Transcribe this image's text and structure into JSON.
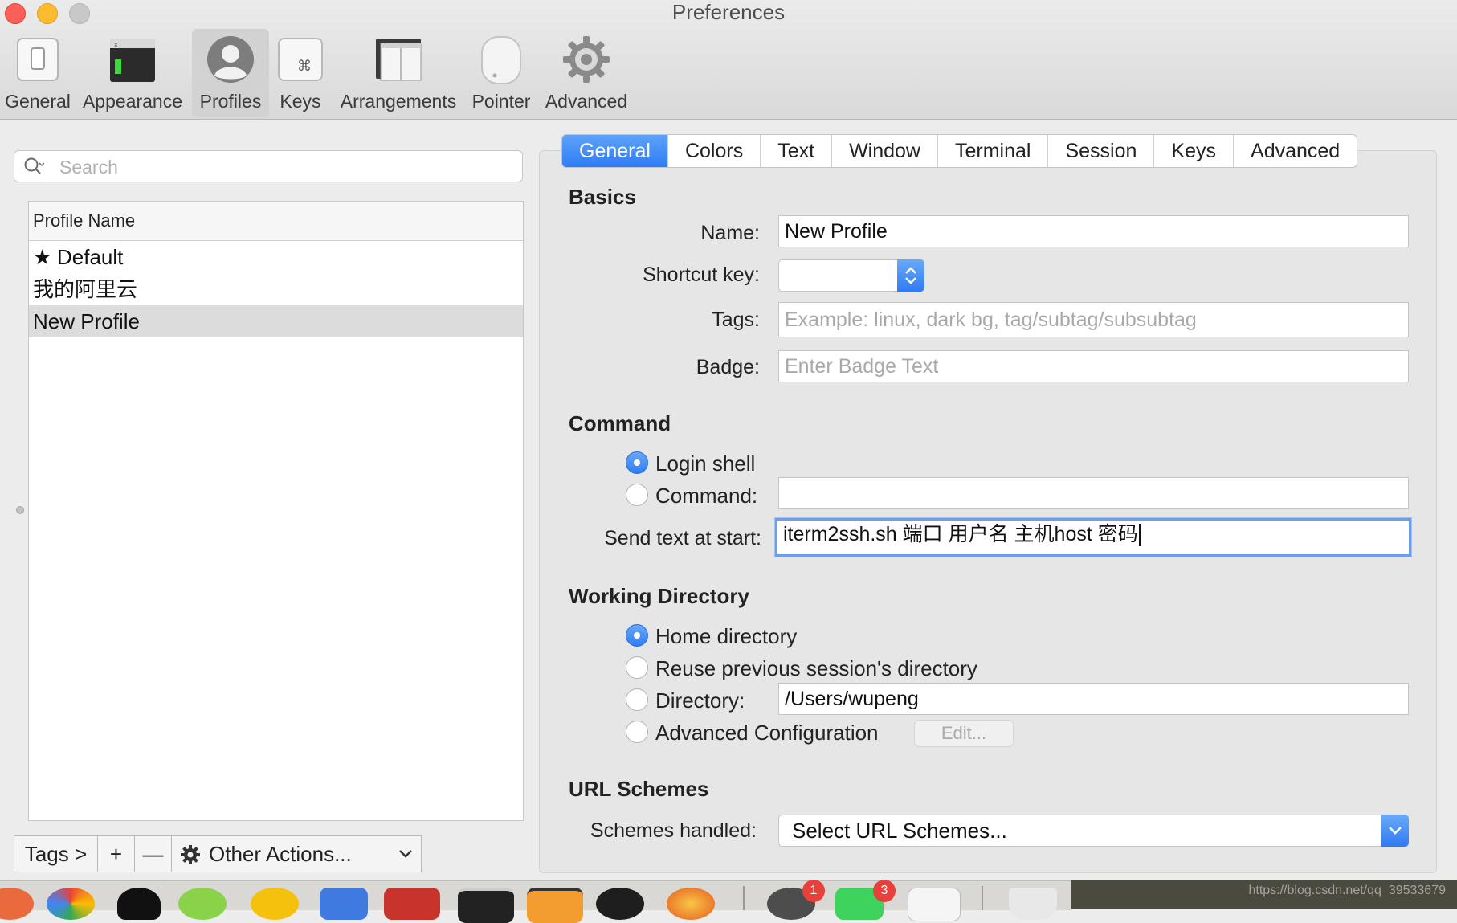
{
  "window": {
    "title": "Preferences"
  },
  "toolbar": {
    "items": [
      {
        "label": "General",
        "icon": "general-icon"
      },
      {
        "label": "Appearance",
        "icon": "appearance-icon"
      },
      {
        "label": "Profiles",
        "icon": "profiles-icon",
        "selected": true
      },
      {
        "label": "Keys",
        "icon": "keys-icon"
      },
      {
        "label": "Arrangements",
        "icon": "arrangements-icon"
      },
      {
        "label": "Pointer",
        "icon": "pointer-icon"
      },
      {
        "label": "Advanced",
        "icon": "advanced-gear-icon"
      }
    ]
  },
  "profiles": {
    "search_placeholder": "Search",
    "column_header": "Profile Name",
    "rows": [
      "Default",
      "我的阿里云",
      "New Profile"
    ],
    "default_marker": "★",
    "selected_index": 2
  },
  "bottom_bar": {
    "tags": "Tags >",
    "add": "+",
    "remove": "—",
    "other_actions": "Other Actions..."
  },
  "tabs": [
    "General",
    "Colors",
    "Text",
    "Window",
    "Terminal",
    "Session",
    "Keys",
    "Advanced"
  ],
  "active_tab": "General",
  "basics": {
    "heading": "Basics",
    "name_label": "Name:",
    "name_value": "New Profile",
    "shortcut_label": "Shortcut key:",
    "shortcut_value": "",
    "tags_label": "Tags:",
    "tags_placeholder": "Example: linux, dark bg, tag/subtag/subsubtag",
    "badge_label": "Badge:",
    "badge_placeholder": "Enter Badge Text"
  },
  "command": {
    "heading": "Command",
    "login_shell": "Login shell",
    "command_label": "Command:",
    "command_value": "",
    "selected": "login_shell",
    "send_text_label": "Send text at start:",
    "send_text_value": "iterm2ssh.sh 端口 用户名 主机host 密码"
  },
  "working_directory": {
    "heading": "Working Directory",
    "home": "Home directory",
    "reuse": "Reuse previous session's directory",
    "directory_label": "Directory:",
    "directory_value": "/Users/wupeng",
    "advanced": "Advanced Configuration",
    "edit_button": "Edit...",
    "selected": "home"
  },
  "url_schemes": {
    "heading": "URL Schemes",
    "label": "Schemes handled:",
    "value": "Select URL Schemes..."
  },
  "dock": {
    "badges": [
      "1",
      "3"
    ]
  },
  "watermark": "https://blog.csdn.net/qq_39533679",
  "colors": {
    "accent": "#2f7cf5",
    "close": "#fc5f57",
    "minimize": "#fdbc2e",
    "badge": "#e8403b"
  }
}
